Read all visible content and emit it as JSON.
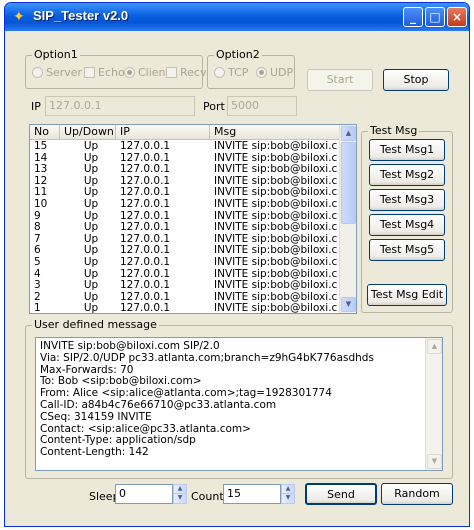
{
  "window": {
    "title": "SIP_Tester v2.0",
    "minimize": "_",
    "maximize": "□",
    "close": "×"
  },
  "option1": {
    "label": "Option1",
    "server": "Server",
    "echo": "Echo",
    "client": "Client",
    "recv": "Recv"
  },
  "option2": {
    "label": "Option2",
    "tcp": "TCP",
    "udp": "UDP"
  },
  "controls": {
    "start": "Start",
    "stop": "Stop"
  },
  "ip": {
    "label": "IP",
    "value": "127.0.0.1"
  },
  "port": {
    "label": "Port",
    "value": "5000"
  },
  "table": {
    "columns": [
      "No",
      "Up/Down",
      "IP",
      "Msg"
    ],
    "rows": [
      [
        "15",
        "Up",
        "127.0.0.1",
        "INVITE sip:bob@biloxi.c..."
      ],
      [
        "14",
        "Up",
        "127.0.0.1",
        "INVITE sip:bob@biloxi.c..."
      ],
      [
        "13",
        "Up",
        "127.0.0.1",
        "INVITE sip:bob@biloxi.c..."
      ],
      [
        "12",
        "Up",
        "127.0.0.1",
        "INVITE sip:bob@biloxi.c..."
      ],
      [
        "11",
        "Up",
        "127.0.0.1",
        "INVITE sip:bob@biloxi.c..."
      ],
      [
        "10",
        "Up",
        "127.0.0.1",
        "INVITE sip:bob@biloxi.c..."
      ],
      [
        "9",
        "Up",
        "127.0.0.1",
        "INVITE sip:bob@biloxi.c..."
      ],
      [
        "8",
        "Up",
        "127.0.0.1",
        "INVITE sip:bob@biloxi.c..."
      ],
      [
        "7",
        "Up",
        "127.0.0.1",
        "INVITE sip:bob@biloxi.c..."
      ],
      [
        "6",
        "Up",
        "127.0.0.1",
        "INVITE sip:bob@biloxi.c..."
      ],
      [
        "5",
        "Up",
        "127.0.0.1",
        "INVITE sip:bob@biloxi.c..."
      ],
      [
        "4",
        "Up",
        "127.0.0.1",
        "INVITE sip:bob@biloxi.c..."
      ],
      [
        "3",
        "Up",
        "127.0.0.1",
        "INVITE sip:bob@biloxi.c..."
      ],
      [
        "2",
        "Up",
        "127.0.0.1",
        "INVITE sip:bob@biloxi.c..."
      ],
      [
        "1",
        "Up",
        "127.0.0.1",
        "INVITE sip:bob@biloxi.c..."
      ]
    ]
  },
  "testmsg": {
    "label": "Test Msg",
    "buttons": [
      "Test Msg1",
      "Test Msg2",
      "Test Msg3",
      "Test Msg4",
      "Test Msg5"
    ],
    "edit": "Test Msg Edit"
  },
  "usermsg": {
    "label": "User defined message",
    "lines": [
      "INVITE sip:bob@biloxi.com SIP/2.0",
      "Via: SIP/2.0/UDP pc33.atlanta.com;branch=z9hG4bK776asdhds",
      "Max-Forwards: 70",
      "To: Bob <sip:bob@biloxi.com>",
      "From: Alice <sip:alice@atlanta.com>;tag=1928301774",
      "Call-ID: a84b4c76e66710@pc33.atlanta.com",
      "CSeq: 314159 INVITE",
      "Contact: <sip:alice@pc33.atlanta.com>",
      "Content-Type: application/sdp",
      "Content-Length: 142"
    ]
  },
  "bottom": {
    "sleep_label": "Sleep",
    "sleep_value": "0",
    "count_label": "Count",
    "count_value": "15",
    "send": "Send",
    "random": "Random"
  }
}
